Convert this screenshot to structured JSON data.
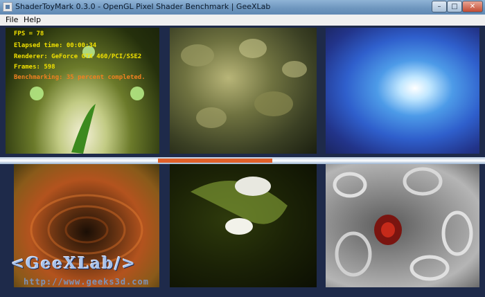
{
  "window": {
    "title": "ShaderToyMark 0.3.0 - OpenGL Pixel Shader Benchmark | GeeXLab",
    "app_icon": "app-icon",
    "controls": {
      "minimize": "–",
      "maximize": "□",
      "close": "✕"
    }
  },
  "menu": {
    "file": "File",
    "help": "Help"
  },
  "hud": {
    "fps": "FPS = 78",
    "elapsed": "Elapsed time: 00:00:34",
    "renderer": "Renderer: GeForce GTX 460/PCI/SSE2",
    "frames": "Frames: 598",
    "benchmark": "Benchmarking: 35 percent completed.",
    "benchmark_percent": 35
  },
  "watermark": {
    "logo": "<GeeXLab/>",
    "url": "http://www.geeks3d.com"
  },
  "colors": {
    "hud_text": "#f0e000",
    "benchmark_text": "#f08020",
    "progress_bar": "#e0602a"
  }
}
